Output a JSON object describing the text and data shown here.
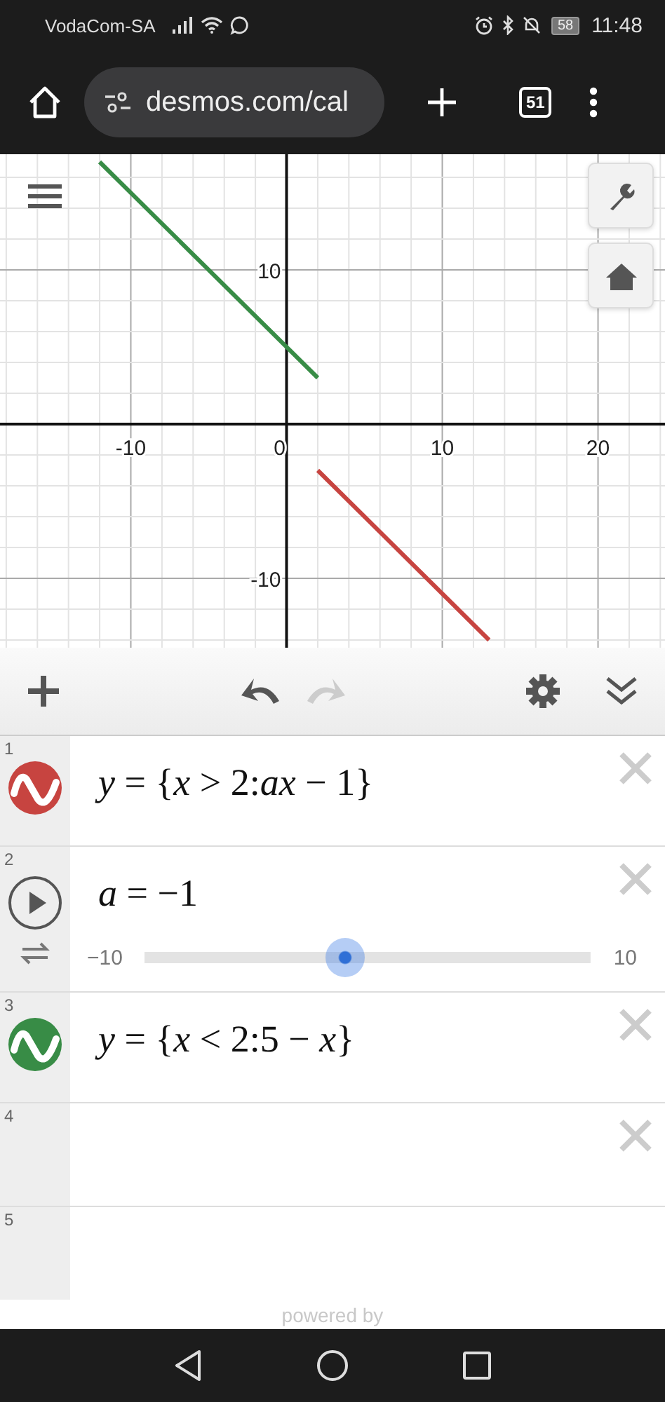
{
  "status_bar": {
    "carrier": "VodaCom-SA",
    "battery": "58",
    "time": "11:48"
  },
  "browser": {
    "url": "desmos.com/cal",
    "tab_count": "51"
  },
  "graph": {
    "chart_data": {
      "type": "line",
      "x": [
        -12,
        2,
        13
      ],
      "series": [
        {
          "color": "#388c46",
          "values": [
            17,
            3,
            null
          ]
        },
        {
          "color": "#c74440",
          "values": [
            null,
            -3,
            -14
          ]
        }
      ],
      "xlim": [
        -18.4,
        24.3
      ],
      "ylim": [
        -14.5,
        17.5
      ],
      "xticks": [
        -10,
        0,
        10,
        20
      ],
      "yticks": [
        -10,
        10
      ],
      "grid": true
    }
  },
  "toolbar": {
    "undo_disabled": false,
    "redo_disabled": true
  },
  "expressions": [
    {
      "kind": "expression",
      "number": "1",
      "color": "#c74440",
      "latex": "*y* = {*x* > 2:*ax* − 1}",
      "closable": true
    },
    {
      "kind": "slider",
      "number": "2",
      "latex": "*a* = −1",
      "min": "−10",
      "max": "10",
      "level": 0.45,
      "closable": true
    },
    {
      "kind": "expression",
      "number": "3",
      "color": "#388c46",
      "latex": "*y* = {*x* < 2:5 − *x*}",
      "closable": true
    },
    {
      "kind": "empty",
      "number": "4",
      "closable": true
    },
    {
      "kind": "empty",
      "number": "5",
      "closable": false
    }
  ],
  "footer": "powered by"
}
